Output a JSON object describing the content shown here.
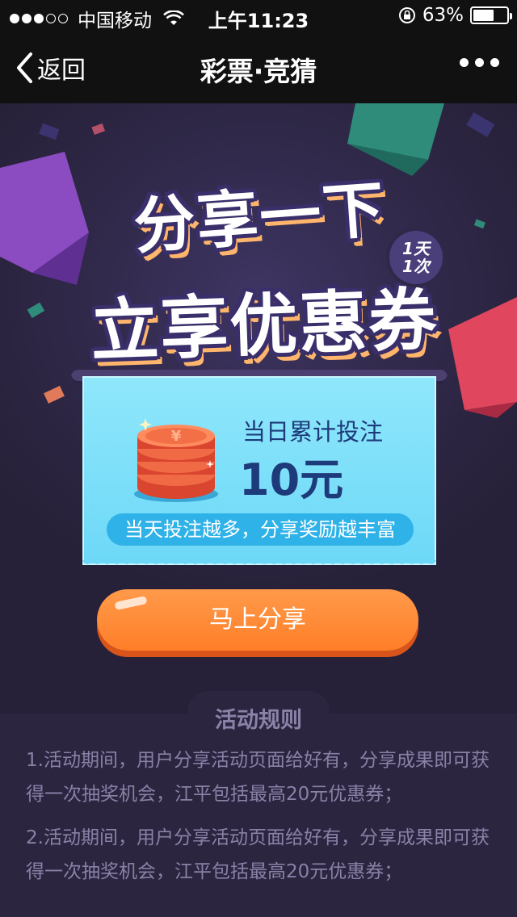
{
  "status_bar": {
    "carrier": "中国移动",
    "time": "上午11:23",
    "battery_percent": "63%",
    "battery_level": 0.63,
    "signal_bars_filled": 3,
    "signal_bars_total": 5
  },
  "nav": {
    "back_label": "返回",
    "title": "彩票·竞猜"
  },
  "hero": {
    "title_line1": "分享一下",
    "title_line2": "立享优惠券",
    "badge_line1": "1天",
    "badge_line2": "1次"
  },
  "card": {
    "label": "当日累计投注",
    "amount": "10元",
    "pill_text": "当天投注越多，分享奖励越丰富"
  },
  "cta": {
    "label": "马上分享"
  },
  "rules": {
    "title": "活动规则",
    "items": [
      "1.活动期间，用户分享活动页面给好有，分享成果即可获得一次抽奖机会，江平包括最高20元优惠券；",
      "2.活动期间，用户分享活动页面给好有，分享成果即可获得一次抽奖机会，江平包括最高20元优惠券；"
    ]
  },
  "colors": {
    "background": "#262038",
    "card": "#7ddff8",
    "cta": "#ff8a36",
    "rule_text": "#8a81a6"
  }
}
